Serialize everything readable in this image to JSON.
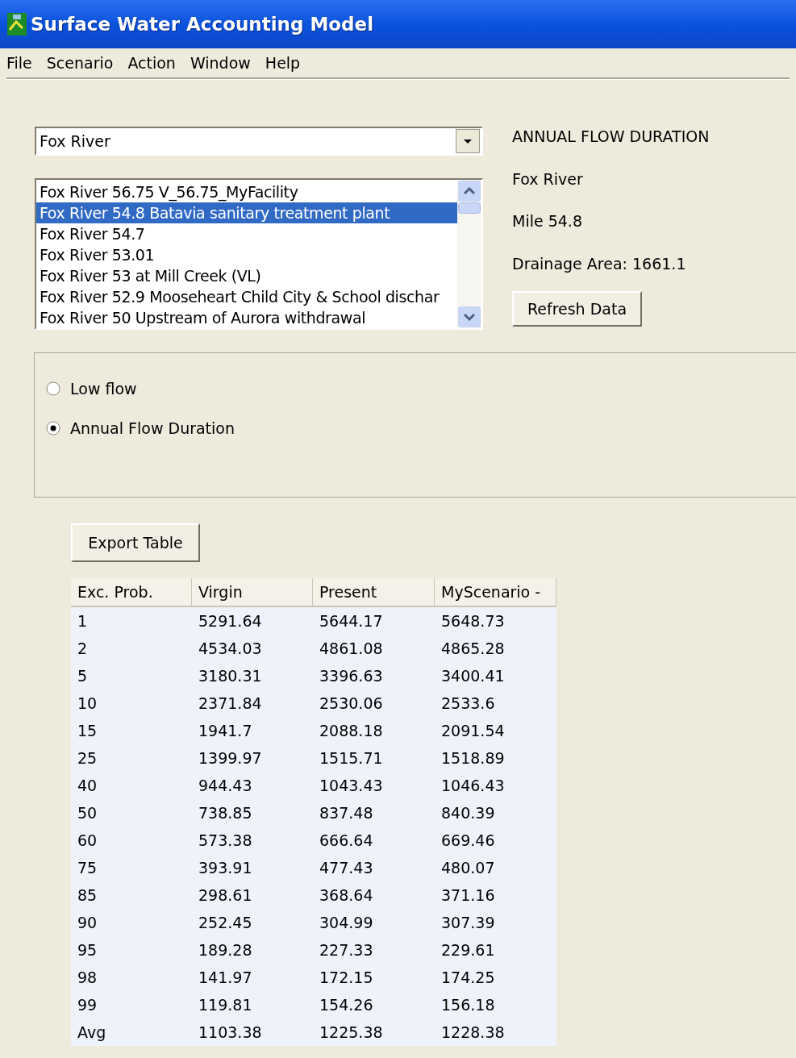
{
  "window": {
    "title": "Surface Water Accounting Model"
  },
  "menu": [
    "File",
    "Scenario",
    "Action",
    "Window",
    "Help"
  ],
  "river_select": {
    "value": "Fox River"
  },
  "site_list": [
    {
      "label": "Fox River 56.75 V_56.75_MyFacility",
      "selected": false
    },
    {
      "label": "Fox River 54.8 Batavia sanitary treatment plant",
      "selected": true
    },
    {
      "label": "Fox River 54.7",
      "selected": false
    },
    {
      "label": "Fox River 53.01",
      "selected": false
    },
    {
      "label": "Fox River 53 at Mill Creek (VL)",
      "selected": false
    },
    {
      "label": "Fox River 52.9 Mooseheart Child City & School dischar",
      "selected": false
    },
    {
      "label": "Fox River 50 Upstream of Aurora withdrawal",
      "selected": false
    }
  ],
  "info": {
    "heading": "ANNUAL FLOW DURATION",
    "river": "Fox River",
    "mile": "Mile 54.8",
    "drainage_area": "Drainage Area: 1661.1"
  },
  "refresh_button": "Refresh Data",
  "options": [
    {
      "label": "Low flow",
      "selected": false
    },
    {
      "label": "Annual Flow Duration",
      "selected": true
    }
  ],
  "export_button": "Export Table",
  "table": {
    "columns": [
      "Exc. Prob.",
      "Virgin",
      "Present",
      "MyScenario -"
    ],
    "rows": [
      [
        "1",
        "5291.64",
        "5644.17",
        "5648.73"
      ],
      [
        "2",
        "4534.03",
        "4861.08",
        "4865.28"
      ],
      [
        "5",
        "3180.31",
        "3396.63",
        "3400.41"
      ],
      [
        "10",
        "2371.84",
        "2530.06",
        "2533.6"
      ],
      [
        "15",
        "1941.7",
        "2088.18",
        "2091.54"
      ],
      [
        "25",
        "1399.97",
        "1515.71",
        "1518.89"
      ],
      [
        "40",
        "944.43",
        "1043.43",
        "1046.43"
      ],
      [
        "50",
        "738.85",
        "837.48",
        "840.39"
      ],
      [
        "60",
        "573.38",
        "666.64",
        "669.46"
      ],
      [
        "75",
        "393.91",
        "477.43",
        "480.07"
      ],
      [
        "85",
        "298.61",
        "368.64",
        "371.16"
      ],
      [
        "90",
        "252.45",
        "304.99",
        "307.39"
      ],
      [
        "95",
        "189.28",
        "227.33",
        "229.61"
      ],
      [
        "98",
        "141.97",
        "172.15",
        "174.25"
      ],
      [
        "99",
        "119.81",
        "154.26",
        "156.18"
      ],
      [
        "Avg",
        "1103.38",
        "1225.38",
        "1228.38"
      ]
    ]
  }
}
